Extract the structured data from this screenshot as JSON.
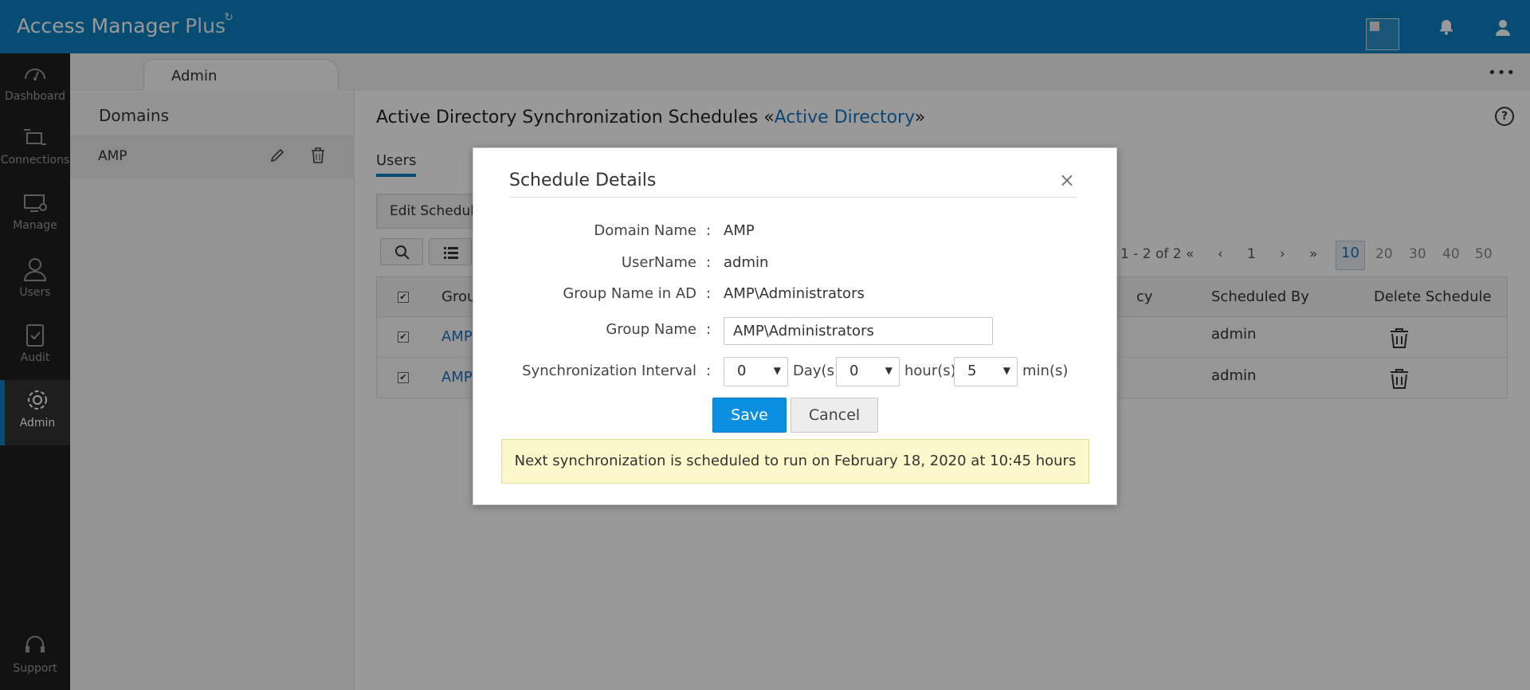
{
  "app": {
    "title": "Access Manager",
    "title_suffix": "Plus"
  },
  "sidebar": {
    "items": [
      {
        "label": "Dashboard",
        "icon": "dashboard-icon"
      },
      {
        "label": "Connections",
        "icon": "connections-icon"
      },
      {
        "label": "Manage",
        "icon": "manage-icon"
      },
      {
        "label": "Users",
        "icon": "users-icon"
      },
      {
        "label": "Audit",
        "icon": "audit-icon"
      },
      {
        "label": "Admin",
        "icon": "gear-icon",
        "active": true
      },
      {
        "label": "Support",
        "icon": "headset-icon"
      }
    ]
  },
  "tabs": {
    "admin": "Admin"
  },
  "domains": {
    "heading": "Domains",
    "items": [
      {
        "name": "AMP"
      }
    ]
  },
  "page": {
    "title_prefix": "Active Directory Synchronization Schedules «",
    "title_link": "Active Directory",
    "title_suffix": "»",
    "subtab": "Users",
    "edit_schedule": "Edit Schedule",
    "pager": {
      "range": "1 - 2 of 2",
      "current_page": "1",
      "page_sizes": [
        "10",
        "20",
        "30",
        "40",
        "50"
      ],
      "selected_size": "10"
    },
    "table": {
      "headers": [
        "Grou",
        "cy",
        "Scheduled By",
        "Delete Schedule"
      ],
      "rows": [
        {
          "group": "AMP",
          "scheduled_by": "admin"
        },
        {
          "group": "AMP",
          "scheduled_by": "admin"
        }
      ]
    }
  },
  "modal": {
    "title": "Schedule Details",
    "close": "×",
    "colon": ":",
    "fields": {
      "domain_name_label": "Domain Name",
      "domain_name_value": "AMP",
      "username_label": "UserName",
      "username_value": "admin",
      "group_ad_label": "Group Name in AD",
      "group_ad_value": "AMP\\Administrators",
      "group_name_label": "Group Name",
      "group_name_value": "AMP\\Administrators",
      "interval_label": "Synchronization Interval",
      "days_value": "0",
      "days_unit": "Day(s)",
      "hours_value": "0",
      "hours_unit": "hour(s)",
      "mins_value": "5",
      "mins_unit": "min(s)"
    },
    "save_label": "Save",
    "cancel_label": "Cancel",
    "note": "Next synchronization is scheduled to run on February 18, 2020 at 10:45 hours"
  }
}
